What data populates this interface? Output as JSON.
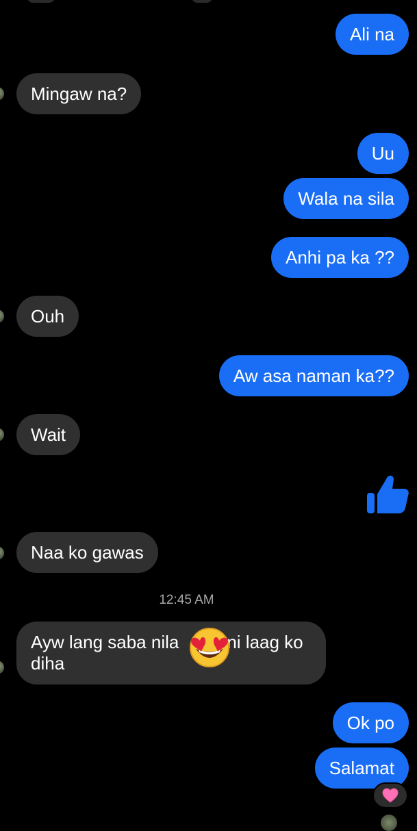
{
  "conversation": {
    "messages": [
      {
        "id": "m1",
        "side": "sent",
        "text": "Ali na"
      },
      {
        "id": "m2",
        "side": "received",
        "text": "Mingaw na?"
      },
      {
        "id": "m3",
        "side": "sent",
        "text": "Uu"
      },
      {
        "id": "m4",
        "side": "sent",
        "text": "Wala na sila"
      },
      {
        "id": "m5",
        "side": "sent",
        "text": "Anhi pa ka ??"
      },
      {
        "id": "m6",
        "side": "received",
        "text": "Ouh"
      },
      {
        "id": "m7",
        "side": "sent",
        "text": "Aw asa naman ka??"
      },
      {
        "id": "m8",
        "side": "received",
        "text": "Wait"
      },
      {
        "id": "m9",
        "side": "sent",
        "sticker": "thumbs-up-icon"
      },
      {
        "id": "m10",
        "side": "received",
        "text": "Naa ko gawas"
      },
      {
        "id": "m11",
        "side": "received",
        "text_before": "Ayw lang saba nila",
        "emoji": "heart-eyes-emoji",
        "text_after": "ni laag ko diha"
      },
      {
        "id": "m12",
        "side": "sent",
        "text": "Ok po"
      },
      {
        "id": "m13",
        "side": "sent",
        "text": "Salamat",
        "reaction": "pink-heart-icon"
      }
    ],
    "timestamp": "12:45 AM"
  },
  "colors": {
    "background": "#000000",
    "sent_bubble": "#1a6ef5",
    "received_bubble": "#303030",
    "timestamp_text": "#a8a8a8",
    "reaction_heart": "#ff6fb5"
  }
}
